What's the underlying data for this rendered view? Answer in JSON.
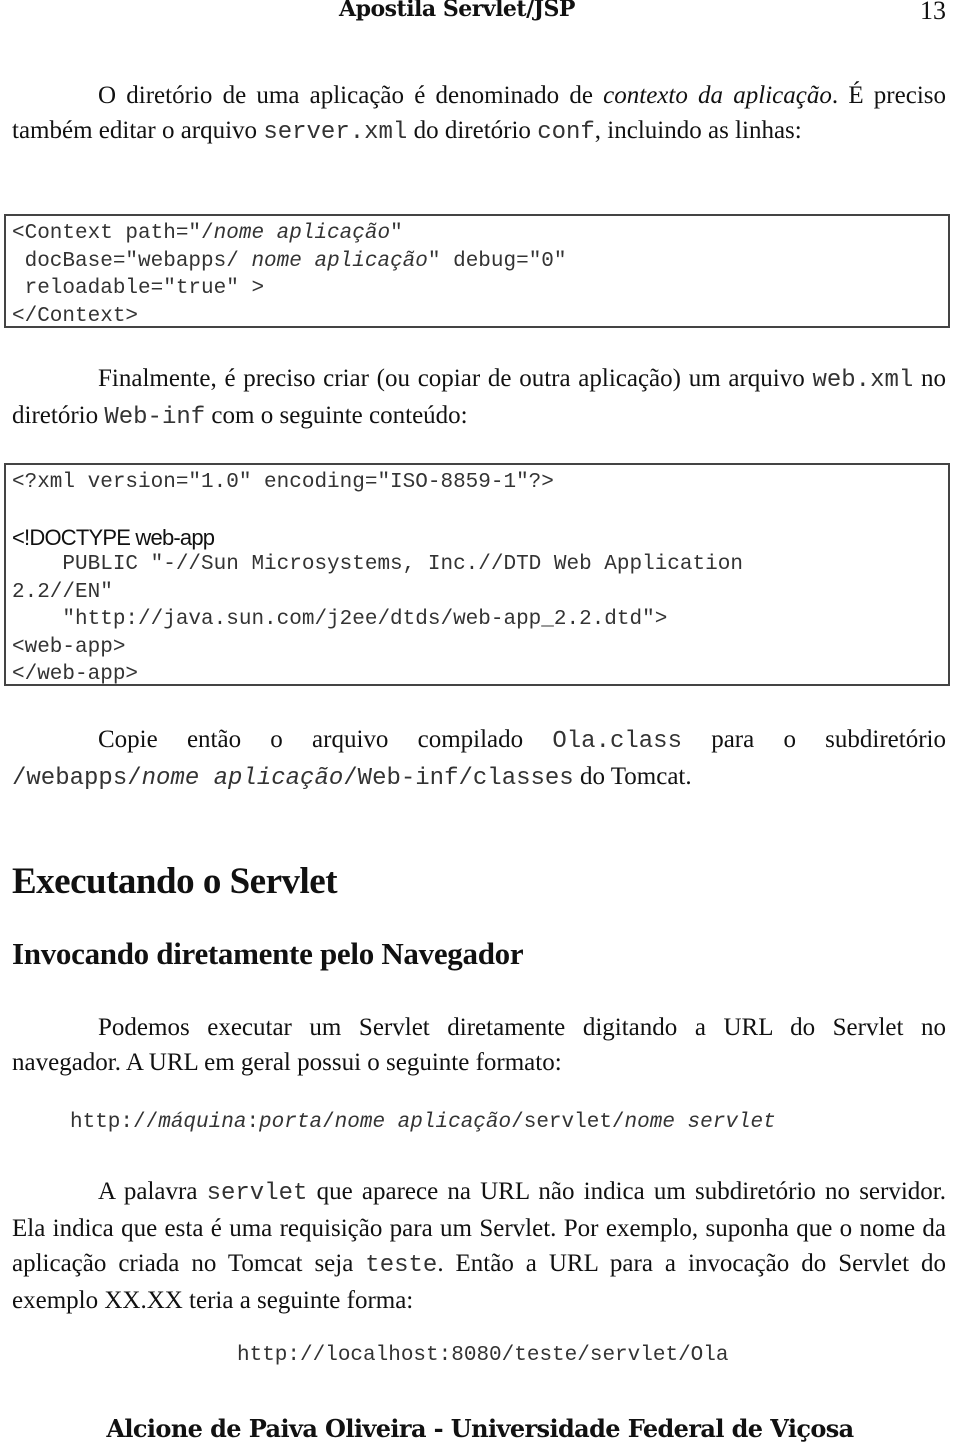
{
  "header": {
    "title": "Apostila Servlet/JSP",
    "page_number": "13"
  },
  "p1": {
    "t1": "O diretório de uma aplicação é denominado de ",
    "t1_italic": "contexto da aplicação",
    "t2": ". É preciso também editar o arquivo ",
    "code1": "server.xml",
    "t3": " do diretório ",
    "code2": "conf",
    "t4": ", incluindo as linhas:"
  },
  "context_code": {
    "l1_pre": "<Context path=\"/",
    "l1_it": "nome aplicação",
    "l1_post": "\"",
    "l2_pre": " docBase=\"webapps/ ",
    "l2_it": "nome aplicação",
    "l2_post": "\" debug=\"0″",
    "l3": " reloadable=\"true\" >",
    "l4": "</Context>"
  },
  "p2": {
    "t1": "Finalmente, é preciso criar (ou copiar de outra aplicação) um arquivo ",
    "code1": "web.xml",
    "t2": " no diretório ",
    "code2": "Web-inf",
    "t3": " com o seguinte conteúdo:"
  },
  "webxml_code": {
    "l1": "<?xml version=\"1.0\" encoding=\"ISO-8859-1\"?>",
    "l2": "<!DOCTYPE web-app",
    "l3": "    PUBLIC \"-//Sun Microsystems, Inc.//DTD Web Application",
    "l4": "2.2//EN\"",
    "l5": "    \"http://java.sun.com/j2ee/dtds/web-app_2.2.dtd\">",
    "l6": "<web-app>",
    "l7": "</web-app>"
  },
  "p3": {
    "t1": "Copie então o arquivo compilado ",
    "code1": "Ola.class",
    "t2": " para o subdiretório ",
    "path_a": "/webapps/",
    "path_it": "nome aplicação",
    "path_b": "/Web-inf/classes",
    "t3": " do Tomcat."
  },
  "section": {
    "heading": "Executando o Servlet",
    "subheading": "Invocando diretamente pelo Navegador"
  },
  "p4": {
    "text": "Podemos executar um Servlet diretamente digitando a URL do Servlet no navegador. A URL em geral possui o seguinte formato:"
  },
  "url_format": {
    "a": "http://",
    "b_it": "máquina",
    "c": ":",
    "d_it": "porta",
    "e": "/",
    "f_it": "nome aplicação",
    "g": "/servlet/",
    "h_it": "nome servlet"
  },
  "p5": {
    "t1": "A palavra ",
    "code1": "servlet",
    "t2": " que aparece na URL não indica um subdiretório no servidor. Ela indica que esta é uma requisição para um Servlet. Por exemplo, suponha que o nome da aplicação criada no Tomcat seja ",
    "code2": "teste",
    "t3": ". Então a URL para a  invocação do Servlet do exemplo XX.XX teria a seguinte forma:"
  },
  "url_example": "http://localhost:8080/teste/servlet/Ola",
  "footer": {
    "text": "Alcione de Paiva Oliveira - Universidade Federal de Viçosa"
  }
}
